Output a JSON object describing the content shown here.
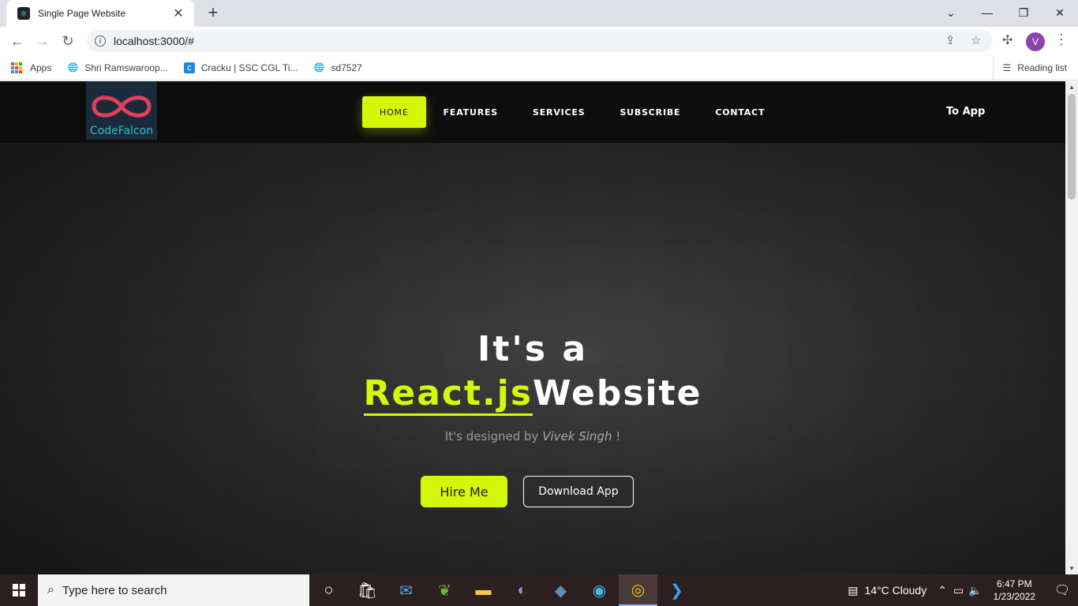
{
  "browser": {
    "tab_title": "Single Page Website",
    "url": "localhost:3000/#",
    "avatar_letter": "V",
    "bookmarks": [
      {
        "label": "Apps",
        "icon": "apps-grid-icon"
      },
      {
        "label": "Shri Ramswaroop...",
        "icon": "globe-icon"
      },
      {
        "label": "Cracku | SSC CGL Ti...",
        "icon": "cracku-icon"
      },
      {
        "label": "sd7527",
        "icon": "globe-icon"
      }
    ],
    "reading_list": "Reading list"
  },
  "site": {
    "logo_text": "CodeFalcon",
    "nav": [
      {
        "label": "HOME",
        "active": true
      },
      {
        "label": "FEATURES",
        "active": false
      },
      {
        "label": "SERVICES",
        "active": false
      },
      {
        "label": "SUBSCRIBE",
        "active": false
      },
      {
        "label": "CONTACT",
        "active": false
      }
    ],
    "to_app": "To App",
    "hero": {
      "line1": "It's a",
      "accent": "React.js",
      "line2_rest": "Website",
      "tagline_prefix": "It's designed by",
      "tagline_name": "Vivek Singh",
      "tagline_suffix": "!",
      "hire_button": "Hire Me",
      "download_button": "Download App"
    },
    "colors": {
      "accent": "#d4f70a",
      "logo_teal": "#2bc0c8",
      "logo_pink": "#e0405a"
    }
  },
  "taskbar": {
    "search_placeholder": "Type here to search",
    "weather": "14°C  Cloudy",
    "time": "6:47 PM",
    "date": "1/23/2022"
  }
}
